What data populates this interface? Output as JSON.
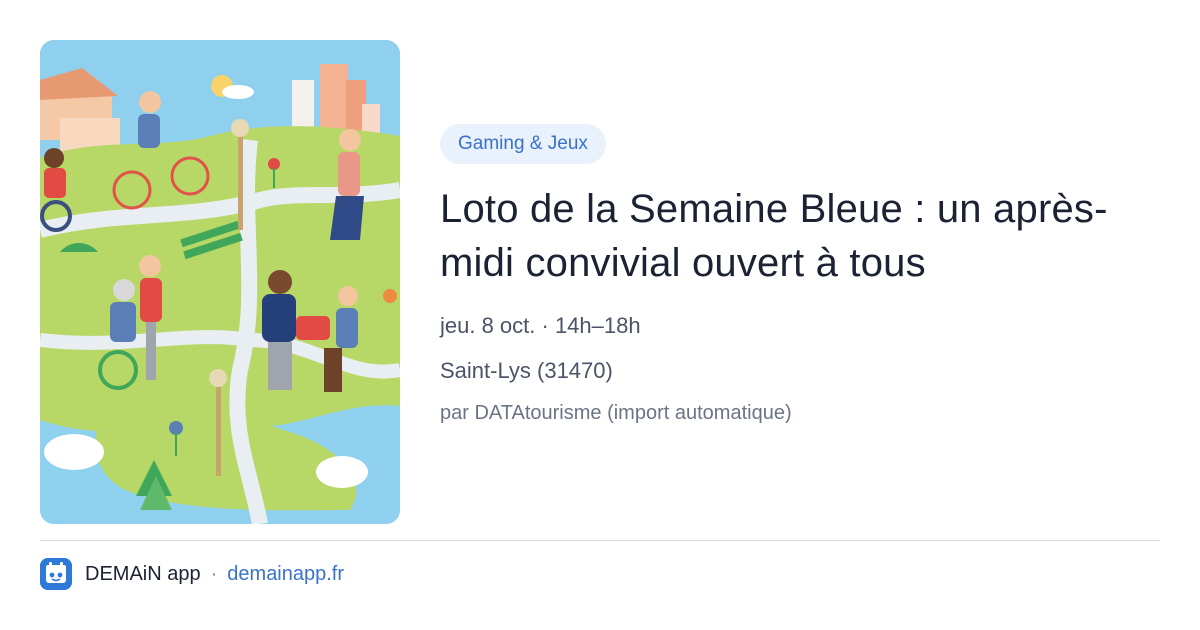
{
  "event": {
    "category": "Gaming & Jeux",
    "title": "Loto de la Semaine Bleue : un après-midi convivial ouvert à tous",
    "datetime": "jeu. 8 oct. · 14h–18h",
    "location": "Saint-Lys (31470)",
    "source": "par DATAtourisme (import automatique)"
  },
  "footer": {
    "app_name": "DEMAiN app",
    "separator": "·",
    "url": "demainapp.fr"
  },
  "colors": {
    "accent": "#3a72c8",
    "pill_background": "#e8f1fc",
    "title": "#1b2233",
    "meta": "#4a5466",
    "logo": "#2f7ad8"
  },
  "icons": {
    "app_logo": "demain-logo-icon"
  }
}
